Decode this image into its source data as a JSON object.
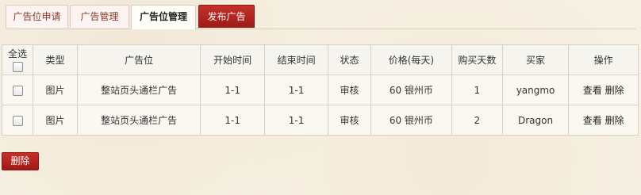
{
  "tabs": [
    {
      "label": "广告位申请"
    },
    {
      "label": "广告管理"
    },
    {
      "label": "广告位管理"
    },
    {
      "label": "发布广告"
    }
  ],
  "table": {
    "headers": {
      "select_all": "全选",
      "type": "类型",
      "position": "广告位",
      "start": "开始时间",
      "end": "结束时间",
      "status": "状态",
      "price": "价格(每天)",
      "days": "购买天数",
      "buyer": "买家",
      "actions": "操作"
    },
    "rows": [
      {
        "type": "图片",
        "position": "整站页头通栏广告",
        "start": "1-1",
        "end": "1-1",
        "status": "审核",
        "price": "60 银州币",
        "days": "1",
        "buyer": "yangmo",
        "view": "查看",
        "delete": "删除"
      },
      {
        "type": "图片",
        "position": "整站页头通栏广告",
        "start": "1-1",
        "end": "1-1",
        "status": "审核",
        "price": "60 银州币",
        "days": "2",
        "buyer": "Dragon",
        "view": "查看",
        "delete": "删除"
      }
    ]
  },
  "delete_button": "删除"
}
